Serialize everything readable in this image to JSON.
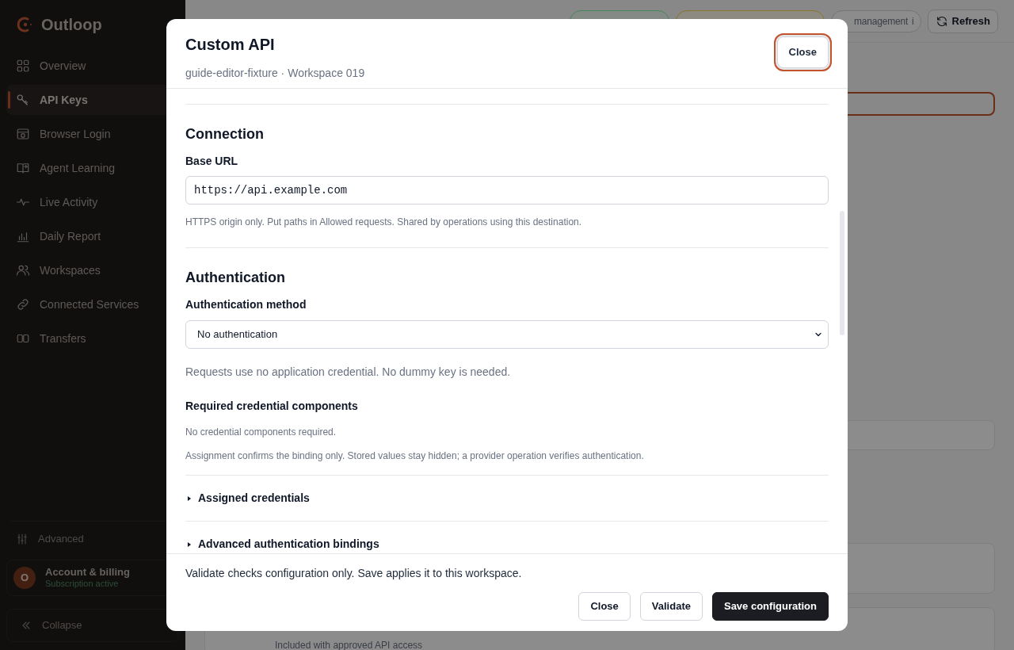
{
  "sidebar": {
    "logo": "Outloop",
    "items": [
      {
        "label": "Overview",
        "selected": false
      },
      {
        "label": "API Keys",
        "selected": true
      },
      {
        "label": "Browser Login",
        "selected": false
      },
      {
        "label": "Agent Learning",
        "selected": false
      },
      {
        "label": "Live Activity",
        "selected": false
      },
      {
        "label": "Daily Report",
        "selected": false
      },
      {
        "label": "Workspaces",
        "selected": false
      },
      {
        "label": "Connected Services",
        "selected": false
      },
      {
        "label": "Transfers",
        "selected": false
      }
    ],
    "advanced": "Advanced",
    "account": {
      "avatar": "O",
      "name": "Account & billing",
      "status": "Subscription active"
    },
    "collapse": "Collapse"
  },
  "page": {
    "badge": "management",
    "badge_info": "i",
    "refresh": "Refresh",
    "row_text": "Included with approved API access"
  },
  "dialog": {
    "title": "Custom API",
    "subtitle": "guide-editor-fixture · Workspace 019",
    "close_top": {
      "label": "Close",
      "focused": true
    },
    "sections": [
      {
        "heading": "Connection",
        "items": [
          {
            "kind": "label",
            "text": "Base URL"
          },
          {
            "kind": "input",
            "value": "https://api.example.com"
          },
          {
            "kind": "hint",
            "text": "HTTPS origin only. Put paths in Allowed requests. Shared by operations using this destination."
          }
        ]
      },
      {
        "heading": "Authentication",
        "items": [
          {
            "kind": "label",
            "text": "Authentication method"
          },
          {
            "kind": "select",
            "value": "No authentication"
          },
          {
            "kind": "note",
            "text": "Requests use no application credential. No dummy key is needed."
          },
          {
            "kind": "subheading",
            "text": "Required credential components"
          },
          {
            "kind": "hint",
            "text": "No credential components required."
          },
          {
            "kind": "hint",
            "text": "Assignment confirms the binding only. Stored values stay hidden; a provider operation verifies authentication."
          }
        ]
      }
    ],
    "disclosures": [
      {
        "label": "Assigned credentials",
        "expanded": false
      },
      {
        "label": "Advanced authentication bindings",
        "expanded": false
      }
    ],
    "footer_text": "Validate checks configuration only. Save applies it to this workspace.",
    "buttons": [
      {
        "label": "Close",
        "kind": "secondary"
      },
      {
        "label": "Validate",
        "kind": "secondary"
      },
      {
        "label": "Save configuration",
        "kind": "primary"
      }
    ]
  }
}
